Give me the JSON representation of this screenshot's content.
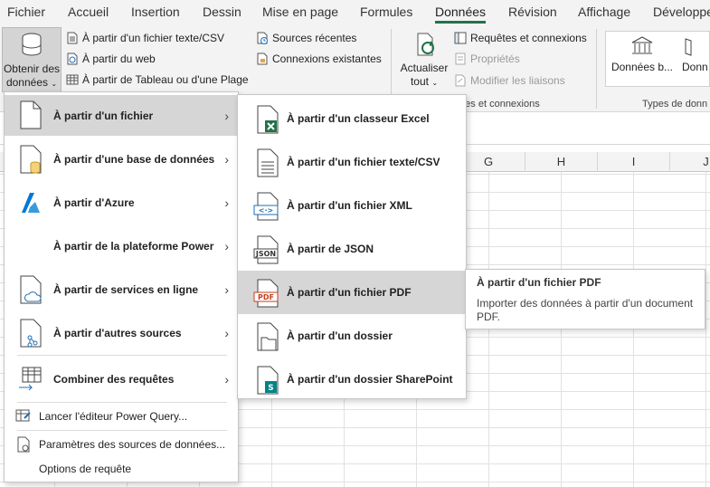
{
  "tabs": [
    {
      "label": "Fichier"
    },
    {
      "label": "Accueil"
    },
    {
      "label": "Insertion"
    },
    {
      "label": "Dessin"
    },
    {
      "label": "Mise en page"
    },
    {
      "label": "Formules"
    },
    {
      "label": "Données"
    },
    {
      "label": "Révision"
    },
    {
      "label": "Affichage"
    },
    {
      "label": "Développe"
    }
  ],
  "ribbon": {
    "get_data_line1": "Obtenir des",
    "get_data_line2": "données",
    "from_text_csv": "À partir d'un fichier texte/CSV",
    "from_web": "À partir du web",
    "from_table_range": "À partir de Tableau ou d'une Plage",
    "recent_sources": "Sources récentes",
    "existing_connections": "Connexions existantes",
    "refresh_line1": "Actualiser",
    "refresh_line2": "tout",
    "queries_connections": "Requêtes et connexions",
    "properties": "Propriétés",
    "edit_links": "Modifier les liaisons",
    "group_queries": "êtes et connexions",
    "group_types": "Types de donn",
    "stocks": "Données b...",
    "stocks2": "Donn"
  },
  "columns": [
    "G",
    "H",
    "I",
    "J"
  ],
  "menu": {
    "items": [
      {
        "label": "À partir d'un fichier",
        "icon": "file-icon"
      },
      {
        "label": "À partir d'une base de données",
        "icon": "database-file-icon"
      },
      {
        "label": "À partir d'Azure",
        "icon": "azure-icon"
      },
      {
        "label": "À partir de la plateforme Power",
        "icon": ""
      },
      {
        "label": "À partir de services en ligne",
        "icon": "cloud-file-icon"
      },
      {
        "label": "À partir d'autres sources",
        "icon": "other-sources-icon"
      },
      {
        "label": "Combiner des requêtes",
        "icon": "combine-icon"
      }
    ],
    "plain": [
      {
        "label": "Lancer l'éditeur Power Query...",
        "icon": "power-query-icon"
      },
      {
        "label": "Paramètres des sources de données...",
        "icon": "settings-file-icon"
      },
      {
        "label": "Options de requête",
        "icon": ""
      }
    ]
  },
  "submenu": {
    "items": [
      {
        "label": "À partir d'un classeur Excel",
        "icon": "excel-file-icon"
      },
      {
        "label": "À partir d'un fichier texte/CSV",
        "icon": "text-file-icon"
      },
      {
        "label": "À partir d'un fichier XML",
        "icon": "xml-file-icon",
        "badge": "<·>"
      },
      {
        "label": "À partir de JSON",
        "icon": "json-file-icon",
        "badge": "JSON"
      },
      {
        "label": "À partir d'un fichier PDF",
        "icon": "pdf-file-icon",
        "badge": "PDF"
      },
      {
        "label": "À partir d'un dossier",
        "icon": "folder-icon"
      },
      {
        "label": "À partir d'un dossier SharePoint",
        "icon": "sharepoint-folder-icon",
        "badge": "S"
      }
    ]
  },
  "tooltip": {
    "title": "À partir d'un fichier PDF",
    "body": "Importer des données à partir d'un document PDF."
  },
  "colors": {
    "accent": "#217346",
    "azure": "#0078d4",
    "sharepoint": "#038387",
    "pdf": "#c43e1c",
    "highlight": "#d6d6d6"
  }
}
